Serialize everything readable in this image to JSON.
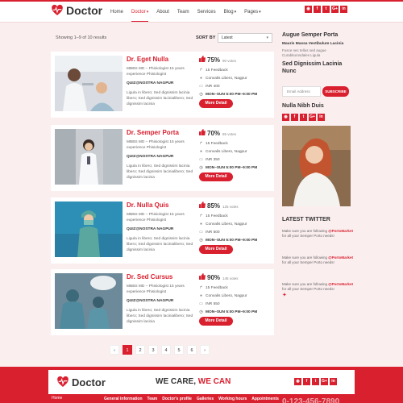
{
  "brand": {
    "name": "Doctor",
    "accent": "#d9202f"
  },
  "nav": {
    "items": [
      {
        "label": "Home",
        "caret": ""
      },
      {
        "label": "Doctor",
        "caret": "▾"
      },
      {
        "label": "About",
        "caret": ""
      },
      {
        "label": "Team",
        "caret": ""
      },
      {
        "label": "Services",
        "caret": ""
      },
      {
        "label": "Blog",
        "caret": "▾"
      },
      {
        "label": "Pages",
        "caret": "▾"
      }
    ]
  },
  "social": [
    "rss",
    "f",
    "tw",
    "G+",
    "in"
  ],
  "listing": {
    "showing": "Showing 1–9 of 10 results",
    "sort_label": "SORT BY",
    "sort_value": "Latest"
  },
  "doctors": [
    {
      "name": "Dr. Eget Nulla",
      "desc": "MBBS MD – Phisiologist 15 years experience Phisiologist",
      "clinic": "QUIZ@NOSTRA NAGPUR",
      "bio": "Ligula in libero; Sed dignissim lacinia libero; Sed dignissim lacinialibero; Sed dignissim lacinia",
      "rating": "75%",
      "votes": "90 votes",
      "feedback": "15 Feedback",
      "location": "Convalis Libero, Nagpur",
      "fee": "INR 400",
      "hours": "MON–SUN 5:00 PM–9:00 PM",
      "button": "More Detail"
    },
    {
      "name": "Dr. Semper Porta",
      "desc": "MBBS MD – Phisiologist 15 years experience Phisiologist",
      "clinic": "QUIZ@NOSTRA NAGPUR",
      "bio": "Ligula in libero; Sed dignissim lacinia libero; Sed dignissim lacinialibero; Sed dignissim lacinia",
      "rating": "70%",
      "votes": "85 votes",
      "feedback": "15 Feedback",
      "location": "Convalis Libero, Nagpur",
      "fee": "INR 350",
      "hours": "MON–SUN 5:00 PM–9:00 PM",
      "button": "More Detail"
    },
    {
      "name": "Dr. Nulla Quis",
      "desc": "MBBS MD – Phisiologist 15 years experience Phisiologist",
      "clinic": "QUIZ@NOSTRA NAGPUR",
      "bio": "Ligula in libero; Sed dignissim lacinia libero; Sed dignissim lacinialibero; Sed dignissim lacinia",
      "rating": "85%",
      "votes": "125 votes",
      "feedback": "15 Feedback",
      "location": "Convalis Libero, Nagpur",
      "fee": "INR 500",
      "hours": "MON–SUN 5:00 PM–9:00 PM",
      "button": "More Detail"
    },
    {
      "name": "Dr. Sed Cursus",
      "desc": "MBBS MD – Phisiologist 15 years experience Phisiologist",
      "clinic": "QUIZ@NOSTRA NAGPUR",
      "bio": "Ligula in libero; Sed dignissim lacinia libero; Sed dignissim lacinialibero; Sed dignissim lacinia",
      "rating": "90%",
      "votes": "145 votes",
      "feedback": "15 Feedback",
      "location": "Convalis Libero, Nagpur",
      "fee": "INR 550",
      "hours": "MON–SUN 5:00 PM–9:00 PM",
      "button": "More Detail"
    }
  ],
  "pagination": {
    "prev": "‹",
    "pages": [
      "1",
      "2",
      "3",
      "4",
      "5",
      "6"
    ],
    "next": "›",
    "active": "1"
  },
  "sidebar": {
    "title": "Augue Semper Porta",
    "subtitle": "Mauris Massa Vestibulum Lacinia",
    "text": "Fusce nec tellus sed augue Curabiturosdales Ligula",
    "title2": "Sed Dignissim Lacinia Nunc",
    "email_placeholder": "Email Address",
    "subscribe": "SUBSCRIBE",
    "profile_name": "Nulla Nibh Duis",
    "twitter_title": "LATEST TWITTER",
    "tweets": [
      {
        "pre": "Make sure you are following",
        "handle": "@PortoMarket",
        "post": "for all your Semper Porto needs!"
      },
      {
        "pre": "Make sure you are following",
        "handle": "@PortoMarket",
        "post": "for all your Semper Porto needs!"
      },
      {
        "pre": "Make sure you are following",
        "handle": "@PortoMarket",
        "post": "for all your Semper Porto needs!"
      }
    ]
  },
  "footer": {
    "brand": "Doctor",
    "slogan_a": "WE CARE, ",
    "slogan_b": "WE CAN",
    "home": "Home",
    "links": [
      "General information",
      "Team",
      "Doctor's profile",
      "Galleries",
      "Working hours",
      "Appointments"
    ],
    "phone": "0-123-456-7890"
  }
}
